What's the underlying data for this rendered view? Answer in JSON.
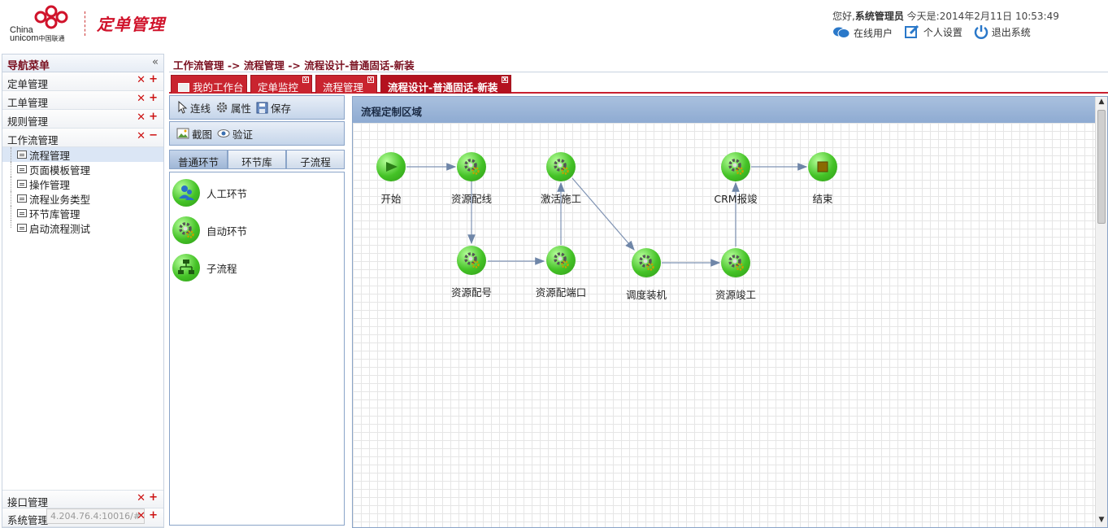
{
  "header": {
    "logo_en_1": "China",
    "logo_en_2": "unicom",
    "logo_cn": "中国联通",
    "app_title": "定单管理",
    "greeting_prefix": "您好,",
    "user": "系统管理员",
    "date_text": " 今天是:2014年2月11日  10:53:49",
    "links": {
      "online": "在线用户",
      "settings": "个人设置",
      "logout": "退出系统"
    }
  },
  "sidebar": {
    "title": "导航菜单",
    "collapse_glyph": "«",
    "groups": [
      {
        "label": "定单管理"
      },
      {
        "label": "工单管理"
      },
      {
        "label": "规则管理"
      },
      {
        "label": "工作流管理"
      }
    ],
    "items": [
      {
        "label": "流程管理"
      },
      {
        "label": "页面模板管理"
      },
      {
        "label": "操作管理"
      },
      {
        "label": "流程业务类型"
      },
      {
        "label": "环节库管理"
      },
      {
        "label": "启动流程测试"
      }
    ],
    "bottom_groups": [
      {
        "label": "接口管理"
      },
      {
        "label": "系统管理"
      }
    ],
    "tooltip": "4.204.76.4:10016/#"
  },
  "breadcrumb": "工作流管理 -> 流程管理 -> 流程设计-普通固话-新装",
  "tabs": [
    {
      "label": "我的工作台"
    },
    {
      "label": "定单监控"
    },
    {
      "label": "流程管理"
    },
    {
      "label": "流程设计-普通固话-新装"
    }
  ],
  "toolbar": {
    "connect": "连线",
    "props": "属性",
    "save": "保存",
    "screenshot": "截图",
    "validate": "验证"
  },
  "palette": {
    "tabs": [
      "普通环节",
      "环节库",
      "子流程"
    ],
    "items": [
      {
        "label": "人工环节",
        "icon": "person-node-icon"
      },
      {
        "label": "自动环节",
        "icon": "gear-node-icon"
      },
      {
        "label": "子流程",
        "icon": "subflow-node-icon"
      }
    ]
  },
  "canvas": {
    "title": "流程定制区域",
    "nodes": [
      {
        "label": "开始",
        "icon": "play-icon"
      },
      {
        "label": "资源配线",
        "icon": "gear-icon"
      },
      {
        "label": "激活施工",
        "icon": "gear-icon"
      },
      {
        "label": "CRM报竣",
        "icon": "gear-icon"
      },
      {
        "label": "结束",
        "icon": "stop-icon"
      },
      {
        "label": "资源配号",
        "icon": "gear-icon"
      },
      {
        "label": "资源配端口",
        "icon": "gear-icon"
      },
      {
        "label": "调度装机",
        "icon": "gear-icon"
      },
      {
        "label": "资源竣工",
        "icon": "gear-icon"
      }
    ]
  },
  "colors": {
    "brand_red": "#c9242f",
    "title_red": "#d0132b",
    "node_green": "#44c226"
  }
}
